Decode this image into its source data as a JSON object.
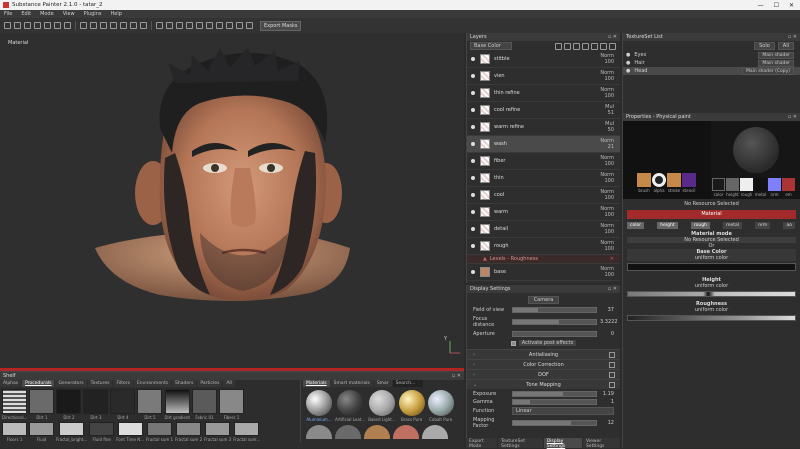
{
  "window": {
    "title": "Substance Painter 2.1.0 - tatar_2",
    "controls": [
      "—",
      "☐",
      "✕"
    ]
  },
  "menu": [
    "File",
    "Edit",
    "Mode",
    "View",
    "Plugins",
    "Help"
  ],
  "toolbar": {
    "export_label": "Export Masks"
  },
  "viewport": {
    "label": "Material",
    "axis_label": "Y"
  },
  "shelf": {
    "title": "Shelf",
    "tabs": [
      "Alphas",
      "Procedurals",
      "Generators",
      "Textures",
      "Filters",
      "Environments",
      "Shaders",
      "Particles",
      "All"
    ],
    "active_tab": "Procedurals",
    "row1": [
      "Directional...",
      "Dirt 1",
      "Dirt 2",
      "Dirt 3",
      "Dirt 4",
      "Dirt 5",
      "Dirt gradient",
      "Fabric 01",
      "Fibers 1"
    ],
    "row2": [
      "Floors 1",
      "Fluid",
      "Fractal_bright...",
      "Fluid fine",
      "Font Time N...",
      "Fractal sum 1",
      "Fractal sum 2",
      "Fractal sum 3",
      "Fractal sum..."
    ],
    "materials_tabs": [
      "Materials",
      "Smart materials",
      "Smar"
    ],
    "materials_search": "Search...",
    "materials": [
      "Aluminium...",
      "Artificial Leat...",
      "Baked Light...",
      "Brass Pure",
      "Cobalt Pure"
    ]
  },
  "layers": {
    "title": "Layers",
    "channel": "Base Color",
    "items": [
      {
        "name": "stitble",
        "blend": "Norm",
        "opacity": "100"
      },
      {
        "name": "vien",
        "blend": "Norm",
        "opacity": "100"
      },
      {
        "name": "thin refine",
        "blend": "Norm",
        "opacity": "100"
      },
      {
        "name": "cool refine",
        "blend": "Mul",
        "opacity": "51"
      },
      {
        "name": "warm refine",
        "blend": "Mul",
        "opacity": "50"
      },
      {
        "name": "wash",
        "blend": "Norm",
        "opacity": "21"
      },
      {
        "name": "fiber",
        "blend": "Norm",
        "opacity": "100"
      },
      {
        "name": "thin",
        "blend": "Norm",
        "opacity": "100"
      },
      {
        "name": "cool",
        "blend": "Norm",
        "opacity": "100"
      },
      {
        "name": "warm",
        "blend": "Norm",
        "opacity": "100"
      },
      {
        "name": "detail",
        "blend": "Norm",
        "opacity": "100"
      },
      {
        "name": "rough",
        "blend": "Norm",
        "opacity": "100"
      }
    ],
    "effect": "Levels - Roughness",
    "base": {
      "name": "base",
      "blend": "Norm",
      "opacity": "100"
    }
  },
  "display": {
    "title": "Display Settings",
    "camera_label": "Camera",
    "fov_label": "Field of view",
    "fov_value": "37",
    "focus_label": "Focus distance",
    "focus_value": "3.3222",
    "aperture_label": "Aperture",
    "aperture_value": "0",
    "post_effects_label": "Activate post effects",
    "sections": [
      "Antialiasing",
      "Color Correction",
      "DOF",
      "Tone Mapping"
    ],
    "exposure_label": "Exposure",
    "exposure_value": "1.19",
    "gamma_label": "Gamma",
    "gamma_value": "1",
    "function_label": "Function",
    "function_value": "Linear",
    "mapping_label": "Mapping Factor",
    "mapping_value": "12",
    "bottom_tabs": [
      "Export Mode",
      "TextureSet Settings",
      "Display Settings",
      "Viewer Settings"
    ],
    "active_bottom_tab": "Display Settings"
  },
  "texture_set": {
    "title": "TextureSet List",
    "solo_label": "Solo",
    "all_label": "All",
    "items": [
      {
        "name": "Eyes",
        "shader": "Main shader"
      },
      {
        "name": "Hair",
        "shader": "Main shader"
      },
      {
        "name": "Head",
        "shader": "Main shader (Copy)"
      }
    ]
  },
  "properties": {
    "title": "Properties - Physical paint",
    "brush_slots": [
      "brush",
      "alpha",
      "stroke",
      "stencil"
    ],
    "material_slots": [
      "color",
      "height",
      "rough",
      "metal",
      "nrm",
      "em"
    ],
    "no_resource": "No Resource Selected",
    "material_header": "Material",
    "channel_chips": [
      "color",
      "height",
      "rough",
      "metal",
      "nrm",
      "ao"
    ],
    "material_mode_label": "Material mode",
    "material_mode_value": "No Resource Selected",
    "or_label": "Or",
    "base_color_label": "Base Color",
    "base_color_value": "uniform color",
    "height_label": "Height",
    "height_value": "uniform color",
    "roughness_label": "Roughness",
    "roughness_value": "uniform color"
  }
}
